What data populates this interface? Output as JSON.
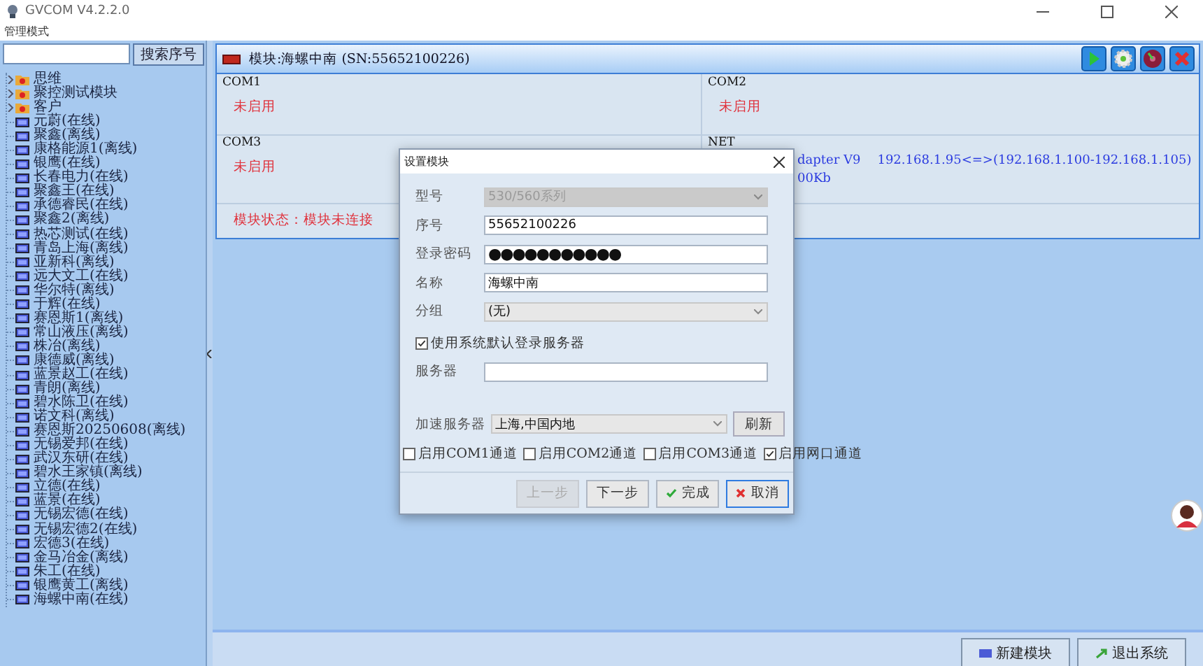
{
  "window": {
    "title": "GVCOM V4.2.2.0"
  },
  "menu": [
    {
      "label": "管理模式"
    }
  ],
  "sidebar": {
    "search_button": "搜索序号",
    "tree": [
      {
        "label": "思维",
        "kind": "folder",
        "expanded": false
      },
      {
        "label": "聚控测试模块",
        "kind": "folder",
        "expanded": false
      },
      {
        "label": "客户",
        "kind": "folder",
        "expanded": false
      },
      {
        "label": "元蔚(在线)",
        "kind": "device"
      },
      {
        "label": "聚鑫(离线)",
        "kind": "device"
      },
      {
        "label": "康格能源1(离线)",
        "kind": "device"
      },
      {
        "label": "银鹰(在线)",
        "kind": "device"
      },
      {
        "label": "长春电力(在线)",
        "kind": "device"
      },
      {
        "label": "聚鑫王(在线)",
        "kind": "device"
      },
      {
        "label": "承德睿民(在线)",
        "kind": "device"
      },
      {
        "label": "聚鑫2(离线)",
        "kind": "device"
      },
      {
        "label": "热芯测试(在线)",
        "kind": "device"
      },
      {
        "label": "青岛上海(离线)",
        "kind": "device"
      },
      {
        "label": "亚新科(离线)",
        "kind": "device"
      },
      {
        "label": "远大文工(在线)",
        "kind": "device"
      },
      {
        "label": "华尔特(离线)",
        "kind": "device"
      },
      {
        "label": "于辉(在线)",
        "kind": "device"
      },
      {
        "label": "赛恩斯1(离线)",
        "kind": "device"
      },
      {
        "label": "常山液压(离线)",
        "kind": "device"
      },
      {
        "label": "株冶(离线)",
        "kind": "device"
      },
      {
        "label": "康德威(离线)",
        "kind": "device"
      },
      {
        "label": "蓝景赵工(在线)",
        "kind": "device"
      },
      {
        "label": "青朗(离线)",
        "kind": "device"
      },
      {
        "label": "碧水陈卫(在线)",
        "kind": "device"
      },
      {
        "label": "诺文科(离线)",
        "kind": "device"
      },
      {
        "label": "赛恩斯20250608(离线)",
        "kind": "device"
      },
      {
        "label": "无锡爱邦(在线)",
        "kind": "device"
      },
      {
        "label": "武汉东研(在线)",
        "kind": "device"
      },
      {
        "label": "碧水王家镇(离线)",
        "kind": "device"
      },
      {
        "label": "立德(在线)",
        "kind": "device"
      },
      {
        "label": "蓝景(在线)",
        "kind": "device"
      },
      {
        "label": "无锡宏德(在线)",
        "kind": "device"
      },
      {
        "label": "无锡宏德2(在线)",
        "kind": "device"
      },
      {
        "label": "宏德3(在线)",
        "kind": "device"
      },
      {
        "label": "金马冶金(离线)",
        "kind": "device"
      },
      {
        "label": "朱工(在线)",
        "kind": "device"
      },
      {
        "label": "银鹰黄工(离线)",
        "kind": "device"
      },
      {
        "label": "海螺中南(在线)",
        "kind": "device"
      }
    ]
  },
  "module": {
    "title": "模块:海螺中南 (SN:55652100226)",
    "ports": [
      {
        "name": "COM1",
        "status": "未启用"
      },
      {
        "name": "COM2",
        "status": "未启用"
      },
      {
        "name": "COM3",
        "status": "未启用"
      }
    ],
    "net": {
      "name": "NET",
      "lines": [
        {
          "parts": [
            "dapter V9",
            "192.168.1.95<=>(192.168.1.100-192.168.1.105)"
          ]
        },
        {
          "parts": [
            "00Kb"
          ]
        }
      ]
    },
    "status": "模块状态：模块未连接"
  },
  "dialog": {
    "title": "设置模块",
    "fields": [
      {
        "label": "型号",
        "kind": "select",
        "value": "530/560系列",
        "disabled": true
      },
      {
        "label": "序号",
        "kind": "text",
        "value": "55652100226",
        "disabled": false
      },
      {
        "label": "登录密码",
        "kind": "password",
        "value": "●●●●●●●●●●●",
        "disabled": false
      },
      {
        "label": "名称",
        "kind": "text",
        "value": "海螺中南",
        "disabled": false
      },
      {
        "label": "分组",
        "kind": "select",
        "value": "(无)",
        "disabled": false
      }
    ],
    "default_server": {
      "label": "使用系统默认登录服务器",
      "checked": true
    },
    "server": {
      "label": "服务器"
    },
    "accel": {
      "label": "加速服务器",
      "value": "上海,中国内地",
      "button": "刷新"
    },
    "channels": [
      {
        "label": "启用COM1通道",
        "checked": false
      },
      {
        "label": "启用COM2通道",
        "checked": false
      },
      {
        "label": "启用COM3通道",
        "checked": false
      },
      {
        "label": "启用网口通道",
        "checked": true
      }
    ],
    "buttons": [
      {
        "label": "上一步",
        "kind": "back",
        "disabled": true,
        "focused": false
      },
      {
        "label": "下一步",
        "kind": "next",
        "disabled": false,
        "focused": false
      },
      {
        "label": "完成",
        "kind": "finish",
        "disabled": false,
        "focused": false
      },
      {
        "label": "取消",
        "kind": "cancel",
        "disabled": false,
        "focused": true
      }
    ]
  },
  "footer": {
    "buttons": [
      {
        "label": "新建模块",
        "kind": "new"
      },
      {
        "label": "退出系统",
        "kind": "exit"
      }
    ]
  }
}
